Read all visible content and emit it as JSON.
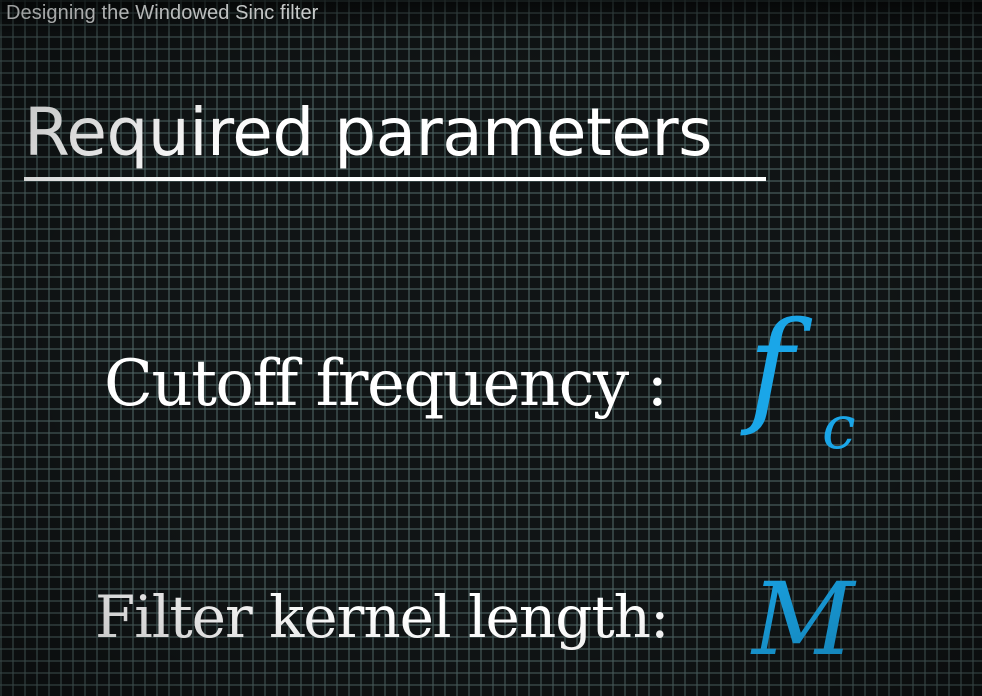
{
  "video": {
    "title": "Designing the Windowed Sinc filter"
  },
  "slide": {
    "heading": "Required parameters",
    "parameters": [
      {
        "label": "Cutoff frequency :",
        "symbol": "f",
        "subscript": "c"
      },
      {
        "label": "Filter kernel length:",
        "symbol": "M"
      }
    ]
  },
  "colors": {
    "background": "#101415",
    "grid": "#4e6464",
    "text": "#ffffff",
    "symbol": "#1aa6e8"
  }
}
